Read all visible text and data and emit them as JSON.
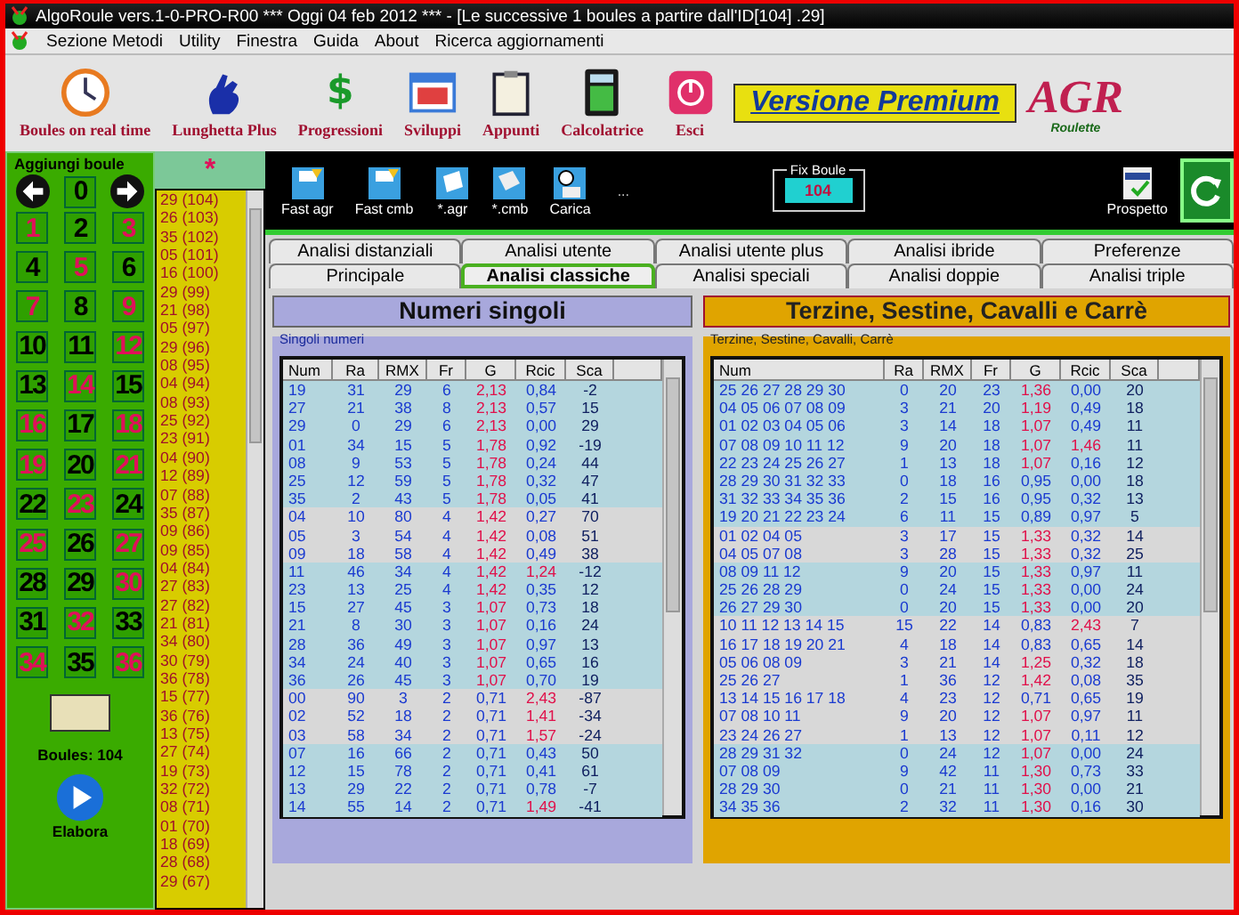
{
  "window": {
    "title": "AlgoRoule vers.1-0-PRO-R00  ***  Oggi 04 feb 2012  ***  - [Le successive 1 boules a partire dall'ID[104] .29]"
  },
  "menu": [
    "Sezione Metodi",
    "Utility",
    "Finestra",
    "Guida",
    "About",
    "Ricerca aggiornamenti"
  ],
  "toolbar": [
    {
      "label": "Boules on real time",
      "kind": "clock"
    },
    {
      "label": "Lunghetta Plus",
      "kind": "hand"
    },
    {
      "label": "Progressioni",
      "kind": "dollar",
      "glyph": "$"
    },
    {
      "label": "Sviluppi",
      "kind": "calendar"
    },
    {
      "label": "Appunti",
      "kind": "clipboard"
    },
    {
      "label": "Calcolatrice",
      "kind": "calculator"
    },
    {
      "label": "Esci",
      "kind": "power"
    }
  ],
  "premium_banner": "Versione Premium",
  "logo": {
    "letters": "AGR",
    "subtitle": "Roulette"
  },
  "add_boule": {
    "title": "Aggiungi boule",
    "zero": "0",
    "count": "Boules: 104",
    "run_button": "Elabora",
    "numbers": [
      {
        "label": "1",
        "color": "#e0105a"
      },
      {
        "label": "2",
        "color": "#000000"
      },
      {
        "label": "3",
        "color": "#e0105a"
      },
      {
        "label": "4",
        "color": "#000000"
      },
      {
        "label": "5",
        "color": "#e0105a"
      },
      {
        "label": "6",
        "color": "#000000"
      },
      {
        "label": "7",
        "color": "#e0105a"
      },
      {
        "label": "8",
        "color": "#000000"
      },
      {
        "label": "9",
        "color": "#e0105a"
      },
      {
        "label": "10",
        "color": "#000000"
      },
      {
        "label": "11",
        "color": "#000000"
      },
      {
        "label": "12",
        "color": "#e0105a"
      },
      {
        "label": "13",
        "color": "#000000"
      },
      {
        "label": "14",
        "color": "#e0105a"
      },
      {
        "label": "15",
        "color": "#000000"
      },
      {
        "label": "16",
        "color": "#e0105a"
      },
      {
        "label": "17",
        "color": "#000000"
      },
      {
        "label": "18",
        "color": "#e0105a"
      },
      {
        "label": "19",
        "color": "#e0105a"
      },
      {
        "label": "20",
        "color": "#000000"
      },
      {
        "label": "21",
        "color": "#e0105a"
      },
      {
        "label": "22",
        "color": "#000000"
      },
      {
        "label": "23",
        "color": "#e0105a"
      },
      {
        "label": "24",
        "color": "#000000"
      },
      {
        "label": "25",
        "color": "#e0105a"
      },
      {
        "label": "26",
        "color": "#000000"
      },
      {
        "label": "27",
        "color": "#e0105a"
      },
      {
        "label": "28",
        "color": "#000000"
      },
      {
        "label": "29",
        "color": "#000000"
      },
      {
        "label": "30",
        "color": "#e0105a"
      },
      {
        "label": "31",
        "color": "#000000"
      },
      {
        "label": "32",
        "color": "#e0105a"
      },
      {
        "label": "33",
        "color": "#000000"
      },
      {
        "label": "34",
        "color": "#e0105a"
      },
      {
        "label": "35",
        "color": "#000000"
      },
      {
        "label": "36",
        "color": "#e0105a"
      }
    ]
  },
  "history": {
    "header": "*",
    "items": [
      "29 (104)",
      "26 (103)",
      "35 (102)",
      "05 (101)",
      "16 (100)",
      "29 (99)",
      "21 (98)",
      "05 (97)",
      "29 (96)",
      "08 (95)",
      "04 (94)",
      "08 (93)",
      "25 (92)",
      "23 (91)",
      "04 (90)",
      "12 (89)",
      "07 (88)",
      "35 (87)",
      "09 (86)",
      "09 (85)",
      "04 (84)",
      "27 (83)",
      "27 (82)",
      "21 (81)",
      "34 (80)",
      "30 (79)",
      "36 (78)",
      "15 (77)",
      "36 (76)",
      "13 (75)",
      "27 (74)",
      "19 (73)",
      "32 (72)",
      "08 (71)",
      "01 (70)",
      "18 (69)",
      "28 (68)",
      "29 (67)"
    ]
  },
  "file_toolbar": [
    {
      "label": "Fast agr",
      "kind": "fast-save"
    },
    {
      "label": "Fast cmb",
      "kind": "fast-save"
    },
    {
      "label": "*.agr",
      "kind": "document"
    },
    {
      "label": "*.cmb",
      "kind": "pages"
    },
    {
      "label": "Carica",
      "kind": "load"
    }
  ],
  "toolbar_more": "...",
  "fix_boule": {
    "label": "Fix Boule",
    "value": "104"
  },
  "report_button": "Prospetto",
  "tabs_back": [
    {
      "label": "Analisi distanziali",
      "selected": false
    },
    {
      "label": "Analisi utente",
      "selected": false
    },
    {
      "label": "Analisi utente plus",
      "selected": false
    },
    {
      "label": "Analisi ibride",
      "selected": false
    },
    {
      "label": "Preferenze",
      "selected": false
    }
  ],
  "tabs_front": [
    {
      "label": "Principale",
      "selected": false
    },
    {
      "label": "Analisi classiche",
      "selected": true
    },
    {
      "label": "Analisi speciali",
      "selected": false
    },
    {
      "label": "Analisi doppie",
      "selected": false
    },
    {
      "label": "Analisi triple",
      "selected": false
    }
  ],
  "panels": [
    {
      "kind": "single",
      "title": "Numeri singoli",
      "group": "Singoli numeri",
      "columns": [
        "Num",
        "Ra",
        "RMX",
        "Fr",
        "G",
        "Rcic",
        "Sca"
      ],
      "rows": [
        {
          "cells": [
            "19",
            "31",
            "29",
            "6",
            "2,13",
            "0,84",
            "-2"
          ],
          "g_alert": true,
          "rcic_alert": false,
          "highlighted": true
        },
        {
          "cells": [
            "27",
            "21",
            "38",
            "8",
            "2,13",
            "0,57",
            "15"
          ],
          "g_alert": true,
          "rcic_alert": false,
          "highlighted": true
        },
        {
          "cells": [
            "29",
            "0",
            "29",
            "6",
            "2,13",
            "0,00",
            "29"
          ],
          "g_alert": true,
          "rcic_alert": false,
          "highlighted": true
        },
        {
          "cells": [
            "01",
            "34",
            "15",
            "5",
            "1,78",
            "0,92",
            "-19"
          ],
          "g_alert": true,
          "rcic_alert": false,
          "highlighted": true
        },
        {
          "cells": [
            "08",
            "9",
            "53",
            "5",
            "1,78",
            "0,24",
            "44"
          ],
          "g_alert": true,
          "rcic_alert": false,
          "highlighted": true
        },
        {
          "cells": [
            "25",
            "12",
            "59",
            "5",
            "1,78",
            "0,32",
            "47"
          ],
          "g_alert": true,
          "rcic_alert": false,
          "highlighted": true
        },
        {
          "cells": [
            "35",
            "2",
            "43",
            "5",
            "1,78",
            "0,05",
            "41"
          ],
          "g_alert": true,
          "rcic_alert": false,
          "highlighted": true
        },
        {
          "cells": [
            "04",
            "10",
            "80",
            "4",
            "1,42",
            "0,27",
            "70"
          ],
          "g_alert": true,
          "rcic_alert": false,
          "highlighted": false
        },
        {
          "cells": [
            "05",
            "3",
            "54",
            "4",
            "1,42",
            "0,08",
            "51"
          ],
          "g_alert": true,
          "rcic_alert": false,
          "highlighted": false
        },
        {
          "cells": [
            "09",
            "18",
            "58",
            "4",
            "1,42",
            "0,49",
            "38"
          ],
          "g_alert": true,
          "rcic_alert": false,
          "highlighted": false
        },
        {
          "cells": [
            "11",
            "46",
            "34",
            "4",
            "1,42",
            "1,24",
            "-12"
          ],
          "g_alert": true,
          "rcic_alert": true,
          "highlighted": true
        },
        {
          "cells": [
            "23",
            "13",
            "25",
            "4",
            "1,42",
            "0,35",
            "12"
          ],
          "g_alert": true,
          "rcic_alert": false,
          "highlighted": true
        },
        {
          "cells": [
            "15",
            "27",
            "45",
            "3",
            "1,07",
            "0,73",
            "18"
          ],
          "g_alert": true,
          "rcic_alert": false,
          "highlighted": true
        },
        {
          "cells": [
            "21",
            "8",
            "30",
            "3",
            "1,07",
            "0,16",
            "24"
          ],
          "g_alert": true,
          "rcic_alert": false,
          "highlighted": true
        },
        {
          "cells": [
            "28",
            "36",
            "49",
            "3",
            "1,07",
            "0,97",
            "13"
          ],
          "g_alert": true,
          "rcic_alert": false,
          "highlighted": true
        },
        {
          "cells": [
            "34",
            "24",
            "40",
            "3",
            "1,07",
            "0,65",
            "16"
          ],
          "g_alert": true,
          "rcic_alert": false,
          "highlighted": true
        },
        {
          "cells": [
            "36",
            "26",
            "45",
            "3",
            "1,07",
            "0,70",
            "19"
          ],
          "g_alert": true,
          "rcic_alert": false,
          "highlighted": true
        },
        {
          "cells": [
            "00",
            "90",
            "3",
            "2",
            "0,71",
            "2,43",
            "-87"
          ],
          "g_alert": false,
          "rcic_alert": true,
          "highlighted": false
        },
        {
          "cells": [
            "02",
            "52",
            "18",
            "2",
            "0,71",
            "1,41",
            "-34"
          ],
          "g_alert": false,
          "rcic_alert": true,
          "highlighted": false
        },
        {
          "cells": [
            "03",
            "58",
            "34",
            "2",
            "0,71",
            "1,57",
            "-24"
          ],
          "g_alert": false,
          "rcic_alert": true,
          "highlighted": false
        },
        {
          "cells": [
            "07",
            "16",
            "66",
            "2",
            "0,71",
            "0,43",
            "50"
          ],
          "g_alert": false,
          "rcic_alert": false,
          "highlighted": true
        },
        {
          "cells": [
            "12",
            "15",
            "78",
            "2",
            "0,71",
            "0,41",
            "61"
          ],
          "g_alert": false,
          "rcic_alert": false,
          "highlighted": true
        },
        {
          "cells": [
            "13",
            "29",
            "22",
            "2",
            "0,71",
            "0,78",
            "-7"
          ],
          "g_alert": false,
          "rcic_alert": false,
          "highlighted": true
        },
        {
          "cells": [
            "14",
            "55",
            "14",
            "2",
            "0,71",
            "1,49",
            "-41"
          ],
          "g_alert": false,
          "rcic_alert": true,
          "highlighted": true
        }
      ]
    },
    {
      "kind": "group",
      "title": "Terzine, Sestine, Cavalli e Carrè",
      "group": "Terzine, Sestine, Cavalli, Carrè",
      "columns": [
        "Num",
        "Ra",
        "RMX",
        "Fr",
        "G",
        "Rcic",
        "Sca"
      ],
      "rows": [
        {
          "cells": [
            "25 26 27 28 29 30",
            "0",
            "20",
            "23",
            "1,36",
            "0,00",
            "20"
          ],
          "g_alert": true,
          "rcic_alert": false,
          "highlighted": true
        },
        {
          "cells": [
            "04 05 06 07 08 09",
            "3",
            "21",
            "20",
            "1,19",
            "0,49",
            "18"
          ],
          "g_alert": true,
          "rcic_alert": false,
          "highlighted": true
        },
        {
          "cells": [
            "01 02 03 04 05 06",
            "3",
            "14",
            "18",
            "1,07",
            "0,49",
            "11"
          ],
          "g_alert": true,
          "rcic_alert": false,
          "highlighted": true
        },
        {
          "cells": [
            "07 08 09 10 11 12",
            "9",
            "20",
            "18",
            "1,07",
            "1,46",
            "11"
          ],
          "g_alert": true,
          "rcic_alert": true,
          "highlighted": true
        },
        {
          "cells": [
            "22 23 24 25 26 27",
            "1",
            "13",
            "18",
            "1,07",
            "0,16",
            "12"
          ],
          "g_alert": true,
          "rcic_alert": false,
          "highlighted": true
        },
        {
          "cells": [
            "28 29 30 31 32 33",
            "0",
            "18",
            "16",
            "0,95",
            "0,00",
            "18"
          ],
          "g_alert": false,
          "rcic_alert": false,
          "highlighted": true
        },
        {
          "cells": [
            "31 32 33 34 35 36",
            "2",
            "15",
            "16",
            "0,95",
            "0,32",
            "13"
          ],
          "g_alert": false,
          "rcic_alert": false,
          "highlighted": true
        },
        {
          "cells": [
            "19 20 21 22 23 24",
            "6",
            "11",
            "15",
            "0,89",
            "0,97",
            "5"
          ],
          "g_alert": false,
          "rcic_alert": false,
          "highlighted": true
        },
        {
          "cells": [
            "01 02 04 05",
            "3",
            "17",
            "15",
            "1,33",
            "0,32",
            "14"
          ],
          "g_alert": true,
          "rcic_alert": false,
          "highlighted": false
        },
        {
          "cells": [
            "04 05 07 08",
            "3",
            "28",
            "15",
            "1,33",
            "0,32",
            "25"
          ],
          "g_alert": true,
          "rcic_alert": false,
          "highlighted": false
        },
        {
          "cells": [
            "08 09 11 12",
            "9",
            "20",
            "15",
            "1,33",
            "0,97",
            "11"
          ],
          "g_alert": true,
          "rcic_alert": false,
          "highlighted": true
        },
        {
          "cells": [
            "25 26 28 29",
            "0",
            "24",
            "15",
            "1,33",
            "0,00",
            "24"
          ],
          "g_alert": true,
          "rcic_alert": false,
          "highlighted": true
        },
        {
          "cells": [
            "26 27 29 30",
            "0",
            "20",
            "15",
            "1,33",
            "0,00",
            "20"
          ],
          "g_alert": true,
          "rcic_alert": false,
          "highlighted": true
        },
        {
          "cells": [
            "10 11 12 13 14 15",
            "15",
            "22",
            "14",
            "0,83",
            "2,43",
            "7"
          ],
          "g_alert": false,
          "rcic_alert": true,
          "highlighted": false
        },
        {
          "cells": [
            "16 17 18 19 20 21",
            "4",
            "18",
            "14",
            "0,83",
            "0,65",
            "14"
          ],
          "g_alert": false,
          "rcic_alert": false,
          "highlighted": false
        },
        {
          "cells": [
            "05 06 08 09",
            "3",
            "21",
            "14",
            "1,25",
            "0,32",
            "18"
          ],
          "g_alert": true,
          "rcic_alert": false,
          "highlighted": false
        },
        {
          "cells": [
            "25 26 27",
            "1",
            "36",
            "12",
            "1,42",
            "0,08",
            "35"
          ],
          "g_alert": true,
          "rcic_alert": false,
          "highlighted": false
        },
        {
          "cells": [
            "13 14 15 16 17 18",
            "4",
            "23",
            "12",
            "0,71",
            "0,65",
            "19"
          ],
          "g_alert": false,
          "rcic_alert": false,
          "highlighted": false
        },
        {
          "cells": [
            "07 08 10 11",
            "9",
            "20",
            "12",
            "1,07",
            "0,97",
            "11"
          ],
          "g_alert": true,
          "rcic_alert": false,
          "highlighted": false
        },
        {
          "cells": [
            "23 24 26 27",
            "1",
            "13",
            "12",
            "1,07",
            "0,11",
            "12"
          ],
          "g_alert": true,
          "rcic_alert": false,
          "highlighted": false
        },
        {
          "cells": [
            "28 29 31 32",
            "0",
            "24",
            "12",
            "1,07",
            "0,00",
            "24"
          ],
          "g_alert": true,
          "rcic_alert": false,
          "highlighted": true
        },
        {
          "cells": [
            "07 08 09",
            "9",
            "42",
            "11",
            "1,30",
            "0,73",
            "33"
          ],
          "g_alert": true,
          "rcic_alert": false,
          "highlighted": true
        },
        {
          "cells": [
            "28 29 30",
            "0",
            "21",
            "11",
            "1,30",
            "0,00",
            "21"
          ],
          "g_alert": true,
          "rcic_alert": false,
          "highlighted": true
        },
        {
          "cells": [
            "34 35 36",
            "2",
            "32",
            "11",
            "1,30",
            "0,16",
            "30"
          ],
          "g_alert": true,
          "rcic_alert": false,
          "highlighted": true
        }
      ]
    }
  ]
}
